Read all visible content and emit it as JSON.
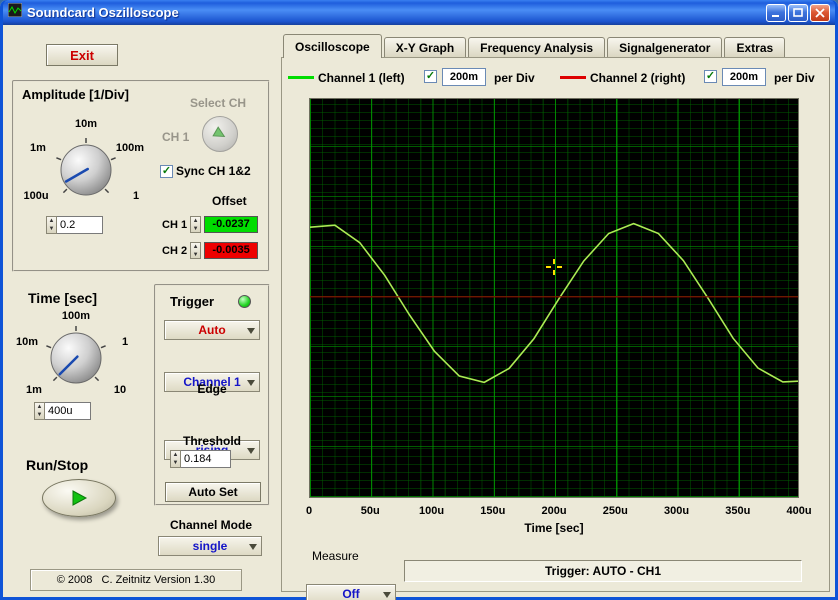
{
  "window": {
    "title": "Soundcard Oszilloscope"
  },
  "left": {
    "exit_label": "Exit",
    "amplitude": {
      "title": "Amplitude [1/Div]",
      "ticks": {
        "top": "10m",
        "left": "1m",
        "right": "100m",
        "bottom_left": "100u",
        "bottom_right": "1"
      },
      "value": "0.2",
      "needle_deg": 240
    },
    "select_ch": {
      "label": "Select CH",
      "channel": "CH 1",
      "sync_label": "Sync CH 1&2",
      "sync_checked": true
    },
    "offset": {
      "title": "Offset",
      "ch1_label": "CH 1",
      "ch1_value": "-0.0237",
      "ch1_color": "#00dd00",
      "ch2_label": "CH 2",
      "ch2_value": "-0.0035",
      "ch2_color": "#ee0000"
    },
    "time": {
      "title": "Time [sec]",
      "ticks": {
        "top": "100m",
        "left": "10m",
        "right": "1",
        "bottom_left": "1m",
        "bottom_right": "10"
      },
      "value": "400u",
      "needle_deg": 225
    },
    "run_stop_label": "Run/Stop",
    "trigger": {
      "title": "Trigger",
      "mode": "Auto",
      "source": "Channel 1",
      "edge_label": "Edge",
      "edge": "rising",
      "threshold_label": "Threshold",
      "threshold": "0.184",
      "auto_set_label": "Auto Set"
    },
    "channel_mode": {
      "label": "Channel Mode",
      "value": "single"
    },
    "footer": "© 2008   C. Zeitnitz Version 1.30"
  },
  "tabs": {
    "items": [
      "Oscilloscope",
      "X-Y Graph",
      "Frequency Analysis",
      "Signalgenerator",
      "Extras"
    ],
    "active": "Oscilloscope"
  },
  "legend": {
    "ch1": {
      "label": "Channel 1 (left)",
      "checked": true,
      "scale": "200m",
      "per_div": "per Div",
      "color": "#00dd00"
    },
    "ch2": {
      "label": "Channel 2 (right)",
      "checked": true,
      "scale": "200m",
      "per_div": "per Div",
      "color": "#dd0000"
    }
  },
  "plot": {
    "x_label": "Time [sec]",
    "x_ticks": [
      "0",
      "50u",
      "100u",
      "150u",
      "200u",
      "250u",
      "300u",
      "350u",
      "400u"
    ],
    "cursor_frac": [
      0.498,
      0.42
    ]
  },
  "measure": {
    "label": "Measure",
    "value": "Off"
  },
  "status": {
    "text": "Trigger: AUTO - CH1"
  },
  "chart_data": {
    "type": "line",
    "xlabel": "Time [sec]",
    "x_range": [
      "0",
      "400u"
    ],
    "x_ticks": [
      "0",
      "50u",
      "100u",
      "150u",
      "200u",
      "250u",
      "300u",
      "350u",
      "400u"
    ],
    "series": [
      {
        "name": "channel-1",
        "color": "#aceb54",
        "stroke_width": 1.6,
        "points_frac": [
          [
            0,
            0.322
          ],
          [
            0.051,
            0.317
          ],
          [
            0.102,
            0.361
          ],
          [
            0.153,
            0.443
          ],
          [
            0.204,
            0.543
          ],
          [
            0.255,
            0.634
          ],
          [
            0.306,
            0.696
          ],
          [
            0.357,
            0.712
          ],
          [
            0.408,
            0.677
          ],
          [
            0.459,
            0.602
          ],
          [
            0.51,
            0.502
          ],
          [
            0.561,
            0.407
          ],
          [
            0.612,
            0.338
          ],
          [
            0.663,
            0.313
          ],
          [
            0.714,
            0.338
          ],
          [
            0.765,
            0.406
          ],
          [
            0.816,
            0.501
          ],
          [
            0.867,
            0.601
          ],
          [
            0.918,
            0.676
          ],
          [
            0.969,
            0.711
          ],
          [
            1,
            0.709
          ]
        ]
      },
      {
        "name": "channel-2",
        "color": "#8f0000",
        "stroke_width": 1.2,
        "points_frac": [
          [
            0,
            0.497
          ],
          [
            1,
            0.497
          ]
        ]
      }
    ]
  }
}
